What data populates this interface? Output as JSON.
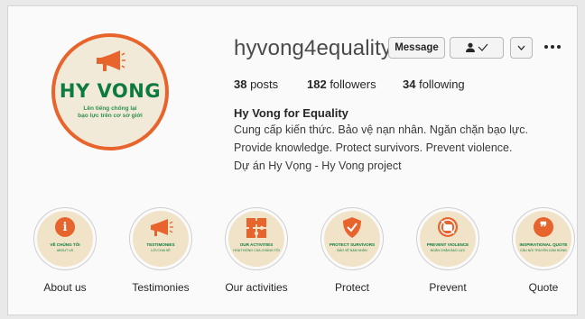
{
  "profile": {
    "avatar": {
      "brand": "HY VONG",
      "tagline_1": "Lên tiếng chống lại",
      "tagline_2": "bạo lực trên cơ sở giới",
      "accent": "#e8642d",
      "brand_color": "#0d7a3e"
    },
    "username": "hyvong4equality",
    "buttons": {
      "message": "Message",
      "follow_icon": "person-check-icon",
      "dropdown_icon": "chevron-down-icon",
      "more_icon": "more-options-icon"
    },
    "stats": {
      "posts_count": "38",
      "posts_label": " posts",
      "followers_count": "182",
      "followers_label": " followers",
      "following_count": "34",
      "following_label": " following"
    },
    "full_name": "Hy Vong for Equality",
    "bio": [
      "Cung cấp kiến thức. Bảo vệ nạn nhân. Ngăn chặn bạo lực.",
      "Provide knowledge. Protect survivors. Prevent violence.",
      "Dự án Hy Vọng - Hy Vong project"
    ]
  },
  "highlights": [
    {
      "label": "About us",
      "icon": "info-icon",
      "glyph": "i",
      "caption": "VỀ CHÚNG TÔI",
      "subcaption": "ABOUT US"
    },
    {
      "label": "Testimonies",
      "icon": "megaphone-icon",
      "glyph": "",
      "caption": "TESTIMONIES",
      "subcaption": "LỜI CHIA SẺ"
    },
    {
      "label": "Our activities",
      "icon": "puzzle-icon",
      "glyph": "",
      "caption": "OUR ACTIVITIES",
      "subcaption": "HOẠT ĐỘNG CỦA CHÚNG TÔI"
    },
    {
      "label": "Protect",
      "icon": "shield-check-icon",
      "glyph": "✓",
      "caption": "PROTECT SURVIVORS",
      "subcaption": "BẢO VỆ NẠN NHÂN"
    },
    {
      "label": "Prevent",
      "icon": "no-violence-icon",
      "glyph": "",
      "caption": "PREVENT VIOLENCE",
      "subcaption": "NGĂN CHẶN BẠO LỰC"
    },
    {
      "label": "Quote",
      "icon": "quote-icon",
      "glyph": "❞",
      "caption": "INSPIRATIONAL QUOTE",
      "subcaption": "CÂU NÓI TRUYỀN CẢM HỨNG"
    }
  ]
}
